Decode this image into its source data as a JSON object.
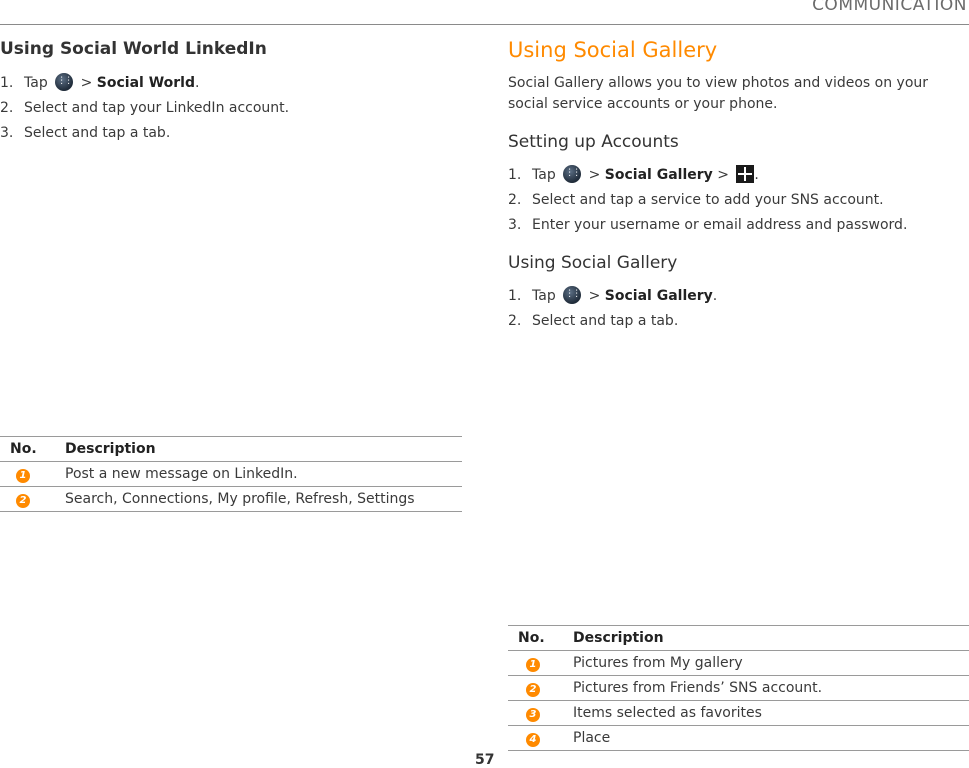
{
  "header": {
    "section_label": "COMMUNICATION"
  },
  "left": {
    "heading": "Using Social World LinkedIn",
    "steps": [
      {
        "num": "1.",
        "pre": "Tap",
        "sep": ">",
        "bold": "Social World",
        "post": "."
      },
      {
        "num": "2.",
        "text": "Select and tap your LinkedIn account."
      },
      {
        "num": "3.",
        "text": "Select and tap a tab."
      }
    ],
    "table": {
      "col_no": "No.",
      "col_desc": "Description",
      "rows": [
        {
          "no": "1",
          "desc": "Post a new message on LinkedIn."
        },
        {
          "no": "2",
          "desc": "Search, Connections, My profile, Refresh, Settings"
        }
      ]
    }
  },
  "right": {
    "title": "Using Social Gallery",
    "intro": "Social Gallery allows you to view photos and videos on your social service accounts or your phone.",
    "setup": {
      "heading": "Setting up Accounts",
      "steps": [
        {
          "num": "1.",
          "pre": "Tap",
          "sep": ">",
          "bold": "Social Gallery",
          "sep2": ">",
          "post": "."
        },
        {
          "num": "2.",
          "text": "Select and tap a service to add your SNS account."
        },
        {
          "num": "3.",
          "text": "Enter your username or email address and password."
        }
      ]
    },
    "using": {
      "heading": "Using Social Gallery",
      "steps": [
        {
          "num": "1.",
          "pre": "Tap",
          "sep": ">",
          "bold": "Social Gallery",
          "post": "."
        },
        {
          "num": "2.",
          "text": "Select and tap a tab."
        }
      ]
    },
    "table": {
      "col_no": "No.",
      "col_desc": "Description",
      "rows": [
        {
          "no": "1",
          "desc": "Pictures from My gallery"
        },
        {
          "no": "2",
          "desc": "Pictures from Friends’ SNS account."
        },
        {
          "no": "3",
          "desc": "Items selected as favorites"
        },
        {
          "no": "4",
          "desc": "Place"
        }
      ]
    }
  },
  "footer": {
    "page_number": "57"
  },
  "colors": {
    "accent": "#ff8a00",
    "text": "#3a3a3a",
    "rule": "#9a9a9a"
  }
}
